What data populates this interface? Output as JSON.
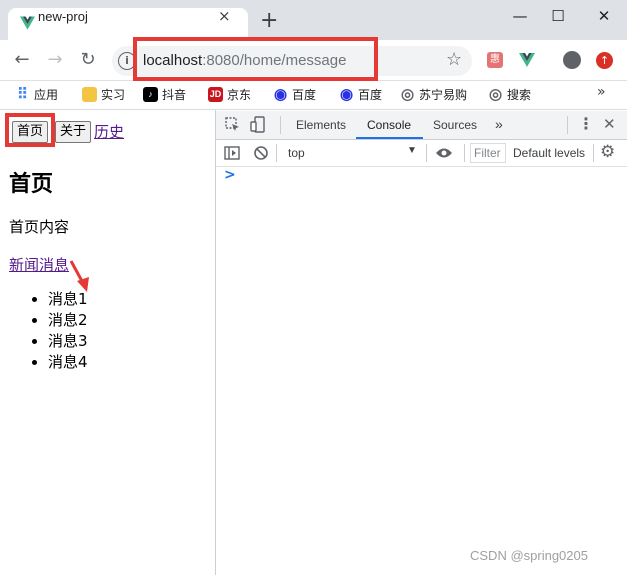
{
  "browser": {
    "tab_title": "new-proj",
    "tab_close": "×",
    "new_tab": "+",
    "window": {
      "minimize": "—",
      "maximize": "☐",
      "close": "✕"
    },
    "url_host": "localhost",
    "url_path": ":8080/home/message",
    "bookmarks": [
      {
        "label": "应用",
        "icon": "apps-grid-icon",
        "color": "#4285f4"
      },
      {
        "label": "实习",
        "icon": "folder-icon",
        "color": "#f4c542"
      },
      {
        "label": "抖音",
        "icon": "douyin-icon",
        "color": "#000000"
      },
      {
        "label": "京东",
        "icon": "jd-icon",
        "color": "#c9151e"
      },
      {
        "label": "百度",
        "icon": "baidu-paw-icon",
        "color": "#2932e1"
      },
      {
        "label": "百度",
        "icon": "baidu-paw-icon",
        "color": "#2932e1"
      },
      {
        "label": "苏宁易购",
        "icon": "globe-icon",
        "color": "#5f6368"
      },
      {
        "label": "搜索",
        "icon": "globe-icon",
        "color": "#5f6368"
      }
    ],
    "more": "»"
  },
  "page": {
    "nav_buttons": [
      "首页",
      "关于"
    ],
    "history_link": "历史",
    "heading": "首页",
    "content": "首页内容",
    "news_link": "新闻消息",
    "messages": [
      "消息1",
      "消息2",
      "消息3",
      "消息4"
    ]
  },
  "devtools": {
    "tabs": [
      "Elements",
      "Console",
      "Sources"
    ],
    "active_tab": "Console",
    "more_tabs": "»",
    "context": "top",
    "filter_placeholder": "Filter",
    "levels": "Default levels",
    "prompt": ">"
  },
  "watermark": "CSDN @spring0205",
  "colors": {
    "annotation_red": "#e53935",
    "link": "#551a8b",
    "console_blue": "#1a73e8"
  }
}
